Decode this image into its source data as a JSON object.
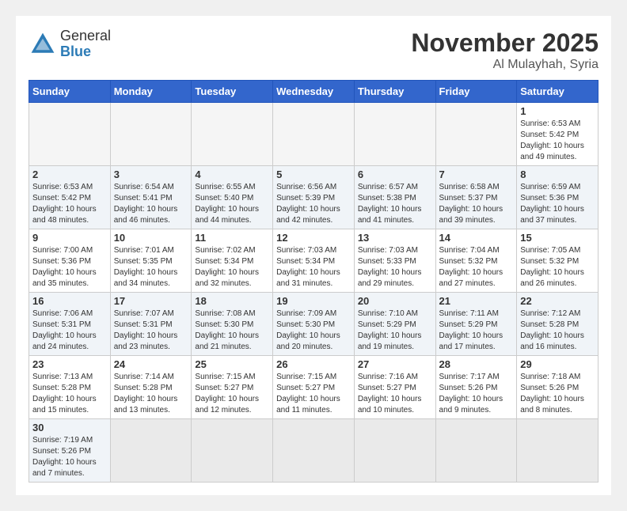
{
  "header": {
    "logo_general": "General",
    "logo_blue": "Blue",
    "month_title": "November 2025",
    "location": "Al Mulayhah, Syria"
  },
  "weekdays": [
    "Sunday",
    "Monday",
    "Tuesday",
    "Wednesday",
    "Thursday",
    "Friday",
    "Saturday"
  ],
  "weeks": [
    [
      {
        "day": "",
        "info": ""
      },
      {
        "day": "",
        "info": ""
      },
      {
        "day": "",
        "info": ""
      },
      {
        "day": "",
        "info": ""
      },
      {
        "day": "",
        "info": ""
      },
      {
        "day": "",
        "info": ""
      },
      {
        "day": "1",
        "info": "Sunrise: 6:53 AM\nSunset: 5:42 PM\nDaylight: 10 hours\nand 49 minutes."
      }
    ],
    [
      {
        "day": "2",
        "info": "Sunrise: 6:53 AM\nSunset: 5:42 PM\nDaylight: 10 hours\nand 48 minutes."
      },
      {
        "day": "3",
        "info": "Sunrise: 6:54 AM\nSunset: 5:41 PM\nDaylight: 10 hours\nand 46 minutes."
      },
      {
        "day": "4",
        "info": "Sunrise: 6:55 AM\nSunset: 5:40 PM\nDaylight: 10 hours\nand 44 minutes."
      },
      {
        "day": "5",
        "info": "Sunrise: 6:56 AM\nSunset: 5:39 PM\nDaylight: 10 hours\nand 42 minutes."
      },
      {
        "day": "6",
        "info": "Sunrise: 6:57 AM\nSunset: 5:38 PM\nDaylight: 10 hours\nand 41 minutes."
      },
      {
        "day": "7",
        "info": "Sunrise: 6:58 AM\nSunset: 5:37 PM\nDaylight: 10 hours\nand 39 minutes."
      },
      {
        "day": "8",
        "info": "Sunrise: 6:59 AM\nSunset: 5:36 PM\nDaylight: 10 hours\nand 37 minutes."
      }
    ],
    [
      {
        "day": "9",
        "info": "Sunrise: 7:00 AM\nSunset: 5:36 PM\nDaylight: 10 hours\nand 35 minutes."
      },
      {
        "day": "10",
        "info": "Sunrise: 7:01 AM\nSunset: 5:35 PM\nDaylight: 10 hours\nand 34 minutes."
      },
      {
        "day": "11",
        "info": "Sunrise: 7:02 AM\nSunset: 5:34 PM\nDaylight: 10 hours\nand 32 minutes."
      },
      {
        "day": "12",
        "info": "Sunrise: 7:03 AM\nSunset: 5:34 PM\nDaylight: 10 hours\nand 31 minutes."
      },
      {
        "day": "13",
        "info": "Sunrise: 7:03 AM\nSunset: 5:33 PM\nDaylight: 10 hours\nand 29 minutes."
      },
      {
        "day": "14",
        "info": "Sunrise: 7:04 AM\nSunset: 5:32 PM\nDaylight: 10 hours\nand 27 minutes."
      },
      {
        "day": "15",
        "info": "Sunrise: 7:05 AM\nSunset: 5:32 PM\nDaylight: 10 hours\nand 26 minutes."
      }
    ],
    [
      {
        "day": "16",
        "info": "Sunrise: 7:06 AM\nSunset: 5:31 PM\nDaylight: 10 hours\nand 24 minutes."
      },
      {
        "day": "17",
        "info": "Sunrise: 7:07 AM\nSunset: 5:31 PM\nDaylight: 10 hours\nand 23 minutes."
      },
      {
        "day": "18",
        "info": "Sunrise: 7:08 AM\nSunset: 5:30 PM\nDaylight: 10 hours\nand 21 minutes."
      },
      {
        "day": "19",
        "info": "Sunrise: 7:09 AM\nSunset: 5:30 PM\nDaylight: 10 hours\nand 20 minutes."
      },
      {
        "day": "20",
        "info": "Sunrise: 7:10 AM\nSunset: 5:29 PM\nDaylight: 10 hours\nand 19 minutes."
      },
      {
        "day": "21",
        "info": "Sunrise: 7:11 AM\nSunset: 5:29 PM\nDaylight: 10 hours\nand 17 minutes."
      },
      {
        "day": "22",
        "info": "Sunrise: 7:12 AM\nSunset: 5:28 PM\nDaylight: 10 hours\nand 16 minutes."
      }
    ],
    [
      {
        "day": "23",
        "info": "Sunrise: 7:13 AM\nSunset: 5:28 PM\nDaylight: 10 hours\nand 15 minutes."
      },
      {
        "day": "24",
        "info": "Sunrise: 7:14 AM\nSunset: 5:28 PM\nDaylight: 10 hours\nand 13 minutes."
      },
      {
        "day": "25",
        "info": "Sunrise: 7:15 AM\nSunset: 5:27 PM\nDaylight: 10 hours\nand 12 minutes."
      },
      {
        "day": "26",
        "info": "Sunrise: 7:15 AM\nSunset: 5:27 PM\nDaylight: 10 hours\nand 11 minutes."
      },
      {
        "day": "27",
        "info": "Sunrise: 7:16 AM\nSunset: 5:27 PM\nDaylight: 10 hours\nand 10 minutes."
      },
      {
        "day": "28",
        "info": "Sunrise: 7:17 AM\nSunset: 5:26 PM\nDaylight: 10 hours\nand 9 minutes."
      },
      {
        "day": "29",
        "info": "Sunrise: 7:18 AM\nSunset: 5:26 PM\nDaylight: 10 hours\nand 8 minutes."
      }
    ],
    [
      {
        "day": "30",
        "info": "Sunrise: 7:19 AM\nSunset: 5:26 PM\nDaylight: 10 hours\nand 7 minutes."
      },
      {
        "day": "",
        "info": ""
      },
      {
        "day": "",
        "info": ""
      },
      {
        "day": "",
        "info": ""
      },
      {
        "day": "",
        "info": ""
      },
      {
        "day": "",
        "info": ""
      },
      {
        "day": "",
        "info": ""
      }
    ]
  ]
}
